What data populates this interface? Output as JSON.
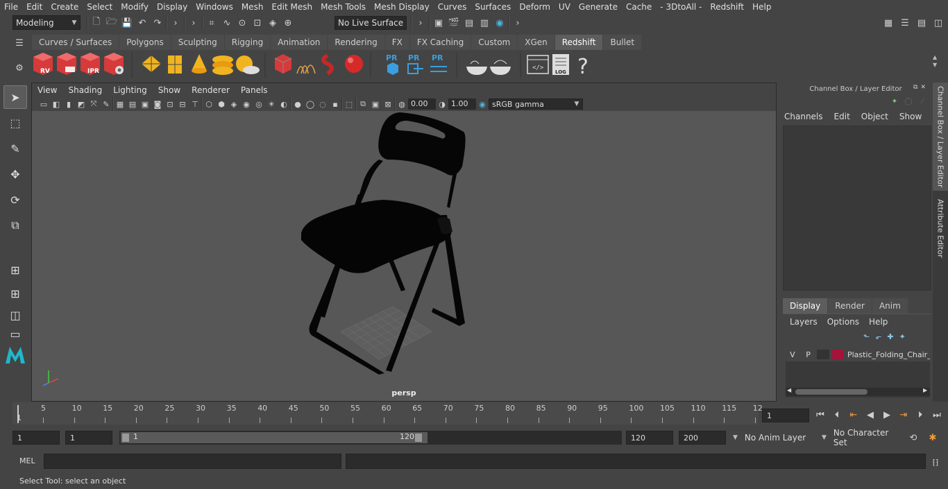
{
  "menubar": [
    "File",
    "Edit",
    "Create",
    "Select",
    "Modify",
    "Display",
    "Windows",
    "Mesh",
    "Edit Mesh",
    "Mesh Tools",
    "Mesh Display",
    "Curves",
    "Surfaces",
    "Deform",
    "UV",
    "Generate",
    "Cache",
    "- 3DtoAll -",
    "Redshift",
    "Help"
  ],
  "status": {
    "mode": "Modeling",
    "live_surface": "No Live Surface"
  },
  "shelf_tabs": [
    "Curves / Surfaces",
    "Polygons",
    "Sculpting",
    "Rigging",
    "Animation",
    "Rendering",
    "FX",
    "FX Caching",
    "Custom",
    "XGen",
    "Redshift",
    "Bullet"
  ],
  "shelf_active_tab": "Redshift",
  "shelf_labels": {
    "rv": "RV",
    "ipr": "IPR",
    "pr1": "PR",
    "pr2": "PR",
    "pr3": "PR",
    "log": "LOG",
    "help": "?"
  },
  "viewport": {
    "menus": [
      "View",
      "Shading",
      "Lighting",
      "Show",
      "Renderer",
      "Panels"
    ],
    "exposure": "0.00",
    "gamma": "1.00",
    "color_space": "sRGB gamma",
    "camera": "persp"
  },
  "channel_box": {
    "title": "Channel Box / Layer Editor",
    "menus": [
      "Channels",
      "Edit",
      "Object",
      "Show"
    ],
    "layer_tabs": [
      "Display",
      "Render",
      "Anim"
    ],
    "layer_menus": [
      "Layers",
      "Options",
      "Help"
    ],
    "layer": {
      "v": "V",
      "p": "P",
      "name": "Plastic_Folding_Chair_",
      "color": "#a3133a"
    }
  },
  "side_tabs": [
    "Channel Box / Layer Editor",
    "Attribute Editor"
  ],
  "timeline": {
    "labels": [
      "5",
      "10",
      "15",
      "20",
      "25",
      "30",
      "35",
      "40",
      "45",
      "50",
      "55",
      "60",
      "65",
      "70",
      "75",
      "80",
      "85",
      "90",
      "95",
      "100",
      "105",
      "110",
      "115",
      "12"
    ],
    "start_label": "1",
    "current_frame": "1"
  },
  "range": {
    "start": "1",
    "start2": "1",
    "slider_start": "1",
    "slider_end": "120",
    "end": "120",
    "max": "200",
    "anim_layer": "No Anim Layer",
    "character_set": "No Character Set"
  },
  "command": {
    "label": "MEL"
  },
  "help_line": "Select Tool: select an object"
}
